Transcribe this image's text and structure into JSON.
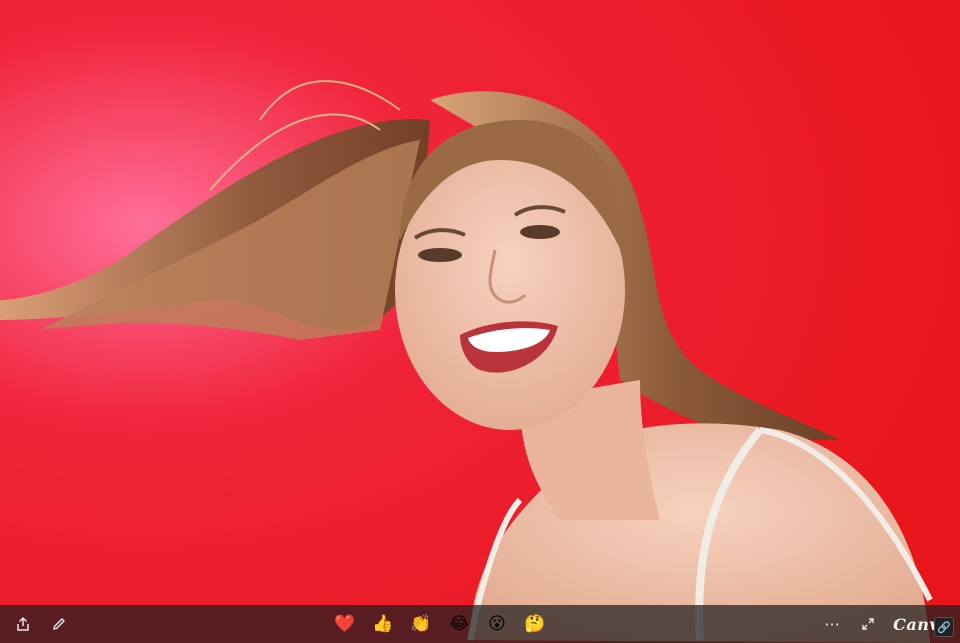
{
  "photo": {
    "subject": "laughing-woman-windblown-hair",
    "background_color": "#ee1c1c"
  },
  "toolbar": {
    "left_buttons": [
      {
        "name": "share-icon"
      },
      {
        "name": "edit-icon"
      }
    ],
    "reactions": [
      {
        "name": "heart-reaction",
        "glyph": "❤️"
      },
      {
        "name": "thumbs-up-reaction",
        "glyph": "👍"
      },
      {
        "name": "clap-reaction",
        "glyph": "👏"
      },
      {
        "name": "laugh-reaction",
        "glyph": "😂"
      },
      {
        "name": "surprised-reaction",
        "glyph": "😮"
      },
      {
        "name": "thinking-reaction",
        "glyph": "🤔"
      }
    ],
    "more_glyph": "···",
    "brand_label": "Canva",
    "corner_glyph": "🔗"
  }
}
